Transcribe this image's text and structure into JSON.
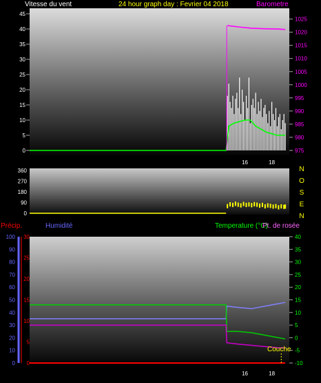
{
  "top": {
    "left_title": "Vitesse du vent",
    "center_title": "24 hour graph day : Fevrier 04 2018",
    "right_title": "Barometre"
  },
  "middle": {
    "compass": [
      "N",
      "O",
      "S",
      "E",
      "N"
    ]
  },
  "bottom": {
    "precip_label": "Précip.",
    "humidity_label": "Humidité",
    "temp_label": "Temperature (°C)",
    "dew_label": "Pt. de rosée",
    "couche_label": "Couche"
  },
  "colors": {
    "wind": "#ffffff",
    "wind_avg": "#00ff00",
    "barometer": "#ff00ff",
    "direction": "#ffff00",
    "precip": "#ff0000",
    "humidity": "#8080ff",
    "temperature": "#00cc00",
    "dewpoint": "#cc00cc",
    "axis_left_top": "#ffffff",
    "axis_right_top": "#ff00ff",
    "axis_precip": "#ff0000",
    "axis_humidity": "#6666ff",
    "axis_temp": "#00ff00"
  },
  "chart_data": [
    {
      "type": "line",
      "name": "wind-barometer",
      "x_ticks": [
        "16",
        "18"
      ],
      "ylim_left": [
        0,
        45
      ],
      "yticks_left": [
        0,
        5,
        10,
        15,
        20,
        25,
        30,
        35,
        40,
        45
      ],
      "ylim_right": [
        975,
        1027
      ],
      "yticks_right": [
        975,
        980,
        985,
        990,
        995,
        1000,
        1005,
        1010,
        1015,
        1020,
        1025
      ],
      "series": [
        {
          "key": "wind_gust",
          "x": [
            0,
            14.6,
            14.7,
            14.8,
            14.9,
            15.0,
            15.1,
            15.2,
            15.3,
            15.4,
            15.5,
            15.6,
            15.7,
            15.8,
            15.9,
            16.0,
            16.1,
            16.2,
            16.3,
            16.4,
            16.5,
            16.6,
            16.7,
            16.8,
            16.9,
            17.0,
            17.1,
            17.2,
            17.3,
            17.4,
            17.5,
            17.6,
            17.7,
            17.8,
            17.9,
            18.0,
            18.1,
            18.2,
            18.3,
            18.4,
            18.5,
            18.6,
            18.7,
            18.8,
            18.9,
            19.0
          ],
          "values": [
            0,
            0,
            18,
            22,
            16,
            14,
            18,
            12,
            17,
            19,
            14,
            24,
            12,
            20,
            16,
            10,
            18,
            14,
            24,
            9,
            15,
            17,
            14,
            19,
            12,
            16,
            13,
            17,
            11,
            14,
            15,
            12,
            9,
            13,
            8,
            16,
            12,
            10,
            14,
            8,
            11,
            12,
            7,
            10,
            12,
            9
          ]
        },
        {
          "key": "wind_avg",
          "x": [
            0,
            14.6,
            14.8,
            15.2,
            15.6,
            16.0,
            16.4,
            16.8,
            17.2,
            17.6,
            18.0,
            18.4,
            18.8,
            19.0
          ],
          "values": [
            0,
            0,
            8,
            9,
            9.5,
            10,
            10,
            8,
            7,
            6,
            5.5,
            5,
            5,
            5
          ]
        },
        {
          "key": "barometer",
          "x": [
            0,
            14.6,
            14.7,
            15.5,
            16.5,
            17.5,
            18.5,
            19.0
          ],
          "values": [
            null,
            null,
            1022.5,
            1022,
            1021.5,
            1021.3,
            1021.2,
            1021
          ]
        }
      ]
    },
    {
      "type": "line",
      "name": "wind-direction",
      "ylim": [
        0,
        360
      ],
      "yticks": [
        0,
        90,
        180,
        270,
        360
      ],
      "series": [
        {
          "key": "direction",
          "x": [
            14.6,
            14.7,
            14.9,
            15.1,
            15.3,
            15.5,
            15.7,
            15.9,
            16.1,
            16.3,
            16.5,
            16.7,
            16.9,
            17.1,
            17.3,
            17.5,
            17.7,
            17.9,
            18.1,
            18.3,
            18.5,
            18.7,
            18.9,
            19.0
          ],
          "values": [
            0,
            60,
            75,
            70,
            80,
            72,
            66,
            78,
            70,
            74,
            68,
            76,
            72,
            64,
            70,
            58,
            66,
            62,
            56,
            60,
            50,
            58,
            54,
            56
          ]
        }
      ]
    },
    {
      "type": "line",
      "name": "temp-humidity-precip",
      "x_ticks": [
        "16",
        "18"
      ],
      "ylim_precip": [
        0,
        30
      ],
      "yticks_precip": [
        0,
        5,
        10,
        15,
        20,
        25,
        30
      ],
      "ylim_humidity": [
        0,
        100
      ],
      "yticks_humidity": [
        0,
        10,
        20,
        30,
        40,
        50,
        60,
        70,
        80,
        90,
        100
      ],
      "ylim_temp": [
        -10,
        40
      ],
      "yticks_temp": [
        -10,
        -5,
        0,
        5,
        10,
        15,
        20,
        25,
        30,
        35,
        40
      ],
      "series": [
        {
          "key": "precip",
          "x": [
            0,
            19.0
          ],
          "values": [
            0,
            0
          ]
        },
        {
          "key": "humidity",
          "x": [
            0,
            14.6,
            14.65,
            15.5,
            16.5,
            17.5,
            18.5,
            19.0
          ],
          "values": [
            35,
            35,
            45,
            44,
            43,
            45,
            47,
            48
          ]
        },
        {
          "key": "temperature",
          "x": [
            0,
            14.6,
            14.65,
            15.5,
            16.5,
            17.5,
            18.5,
            19.0
          ],
          "values": [
            13,
            13,
            2.5,
            2.5,
            2,
            1,
            0,
            -0.5
          ]
        },
        {
          "key": "dewpoint",
          "x": [
            0,
            14.6,
            14.65,
            15.5,
            16.5,
            17.5,
            18.5,
            19.0
          ],
          "values": [
            5,
            5,
            -2,
            -2.5,
            -3,
            -3.5,
            -4,
            -4
          ]
        }
      ]
    }
  ]
}
